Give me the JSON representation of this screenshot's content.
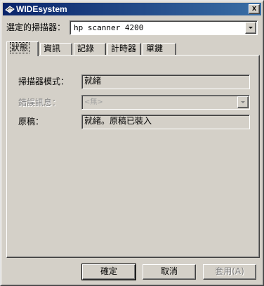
{
  "window": {
    "title": "WIDEsystem",
    "close_label": "x"
  },
  "scanner": {
    "label": "選定的掃描器：",
    "selected": "hp scanner 4200"
  },
  "tabs": [
    {
      "label": "狀態",
      "active": true
    },
    {
      "label": "資訊",
      "active": false
    },
    {
      "label": "記錄",
      "active": false
    },
    {
      "label": "計時器",
      "active": false
    },
    {
      "label": "單鍵",
      "active": false
    }
  ],
  "status": {
    "mode_label": "掃描器模式：",
    "mode_value": "就緒",
    "error_label": "錯誤訊息：",
    "error_placeholder": "<無>",
    "original_label": "原稿：",
    "original_value": "就緒。原稿已裝入"
  },
  "buttons": {
    "ok": "確定",
    "cancel": "取消",
    "apply": "套用(A)"
  },
  "colors": {
    "titlebar_start": "#0a246a",
    "titlebar_end": "#3a6ea5",
    "face": "#d4d0c8"
  }
}
